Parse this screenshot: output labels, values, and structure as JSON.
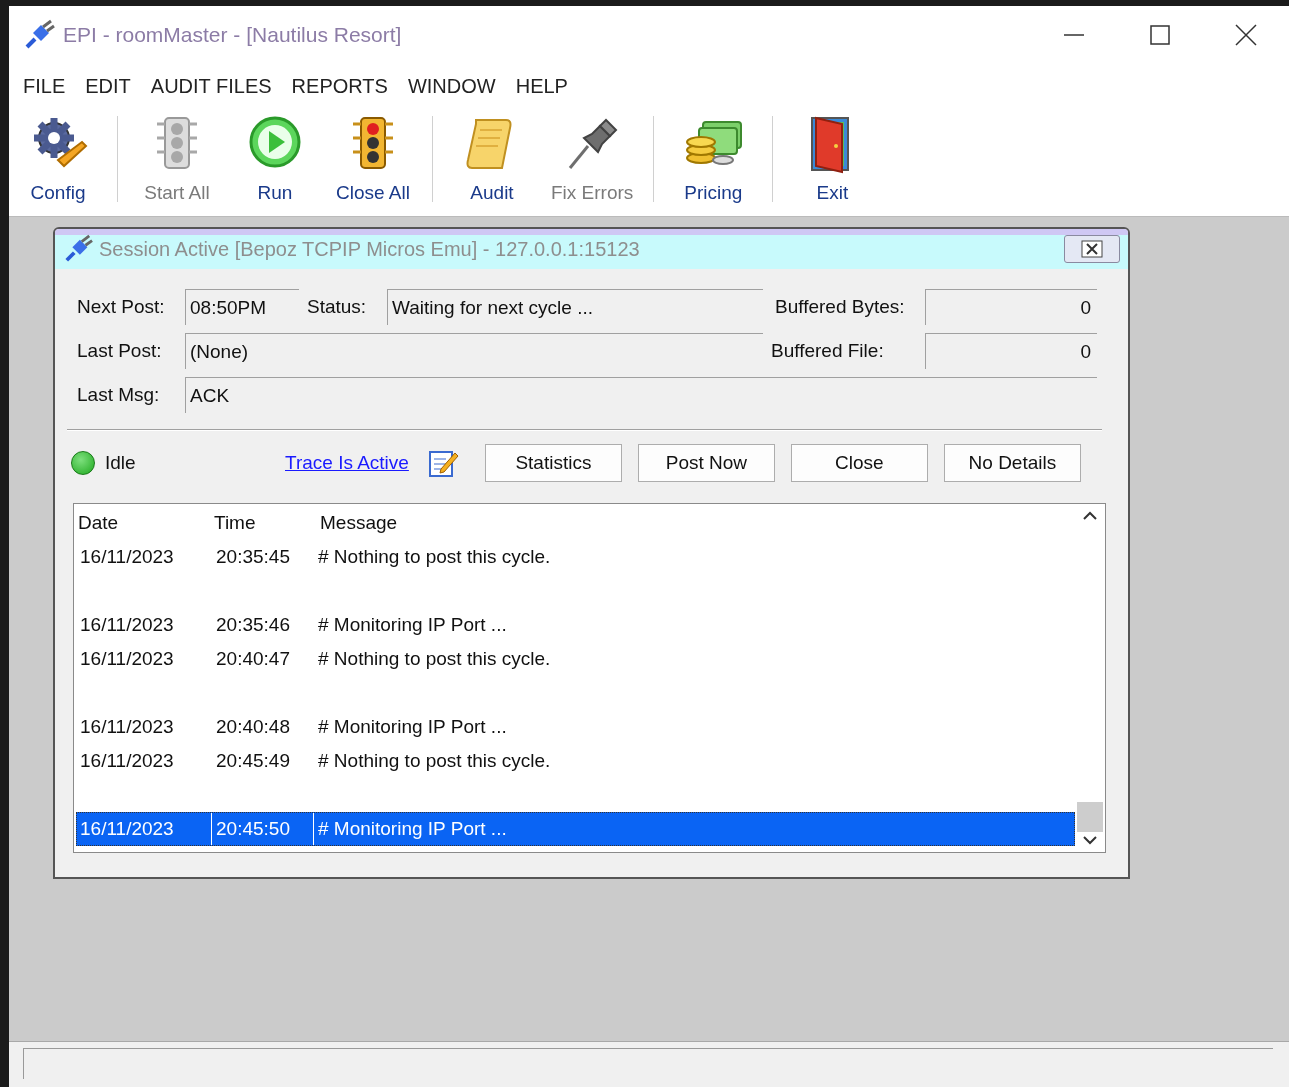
{
  "window": {
    "title": "EPI - roomMaster - [Nautilus Resort]"
  },
  "menu": [
    "FILE",
    "EDIT",
    "AUDIT FILES",
    "REPORTS",
    "WINDOW",
    "HELP"
  ],
  "toolbar": [
    {
      "kind": "button",
      "label": "Config",
      "disabled": false
    },
    {
      "kind": "separator"
    },
    {
      "kind": "button",
      "label": "Start All",
      "disabled": true
    },
    {
      "kind": "button",
      "label": "Run",
      "disabled": false
    },
    {
      "kind": "button",
      "label": "Close All",
      "disabled": false
    },
    {
      "kind": "separator"
    },
    {
      "kind": "button",
      "label": "Audit",
      "disabled": false
    },
    {
      "kind": "button",
      "label": "Fix Errors",
      "disabled": true
    },
    {
      "kind": "separator"
    },
    {
      "kind": "button",
      "label": "Pricing",
      "disabled": false
    },
    {
      "kind": "separator"
    },
    {
      "kind": "button",
      "label": "Exit",
      "disabled": false
    }
  ],
  "session": {
    "title": "Session Active [Bepoz TCPIP Micros Emu] - 127.0.0.1:15123",
    "next_post": {
      "label": "Next Post:",
      "value": "08:50PM"
    },
    "status": {
      "label": "Status:",
      "value": "Waiting for next cycle ..."
    },
    "buffered_bytes": {
      "label": "Buffered Bytes:",
      "value": "0"
    },
    "last_post": {
      "label": "Last Post:",
      "value": "(None)"
    },
    "buffered_file": {
      "label": "Buffered File:",
      "value": "0"
    },
    "last_msg": {
      "label": "Last Msg:",
      "value": "ACK"
    },
    "state": "Idle",
    "trace_link": "Trace Is Active",
    "buttons": [
      "Statistics",
      "Post Now",
      "Close",
      "No Details"
    ],
    "log": {
      "columns": [
        "Date",
        "Time",
        "Message"
      ],
      "rows": [
        {
          "kind": "entry",
          "date": "16/11/2023",
          "time": "20:35:45",
          "message": "# Nothing to post this cycle.",
          "selected": false
        },
        {
          "kind": "blank",
          "selected": false
        },
        {
          "kind": "entry",
          "date": "16/11/2023",
          "time": "20:35:46",
          "message": "# Monitoring IP Port ...",
          "selected": false
        },
        {
          "kind": "entry",
          "date": "16/11/2023",
          "time": "20:40:47",
          "message": "# Nothing to post this cycle.",
          "selected": false
        },
        {
          "kind": "blank",
          "selected": false
        },
        {
          "kind": "entry",
          "date": "16/11/2023",
          "time": "20:40:48",
          "message": "# Monitoring IP Port ...",
          "selected": false
        },
        {
          "kind": "entry",
          "date": "16/11/2023",
          "time": "20:45:49",
          "message": "# Nothing to post this cycle.",
          "selected": false
        },
        {
          "kind": "blank",
          "selected": false
        },
        {
          "kind": "entry",
          "date": "16/11/2023",
          "time": "20:45:50",
          "message": "# Monitoring IP Port ...",
          "selected": true
        }
      ]
    }
  }
}
